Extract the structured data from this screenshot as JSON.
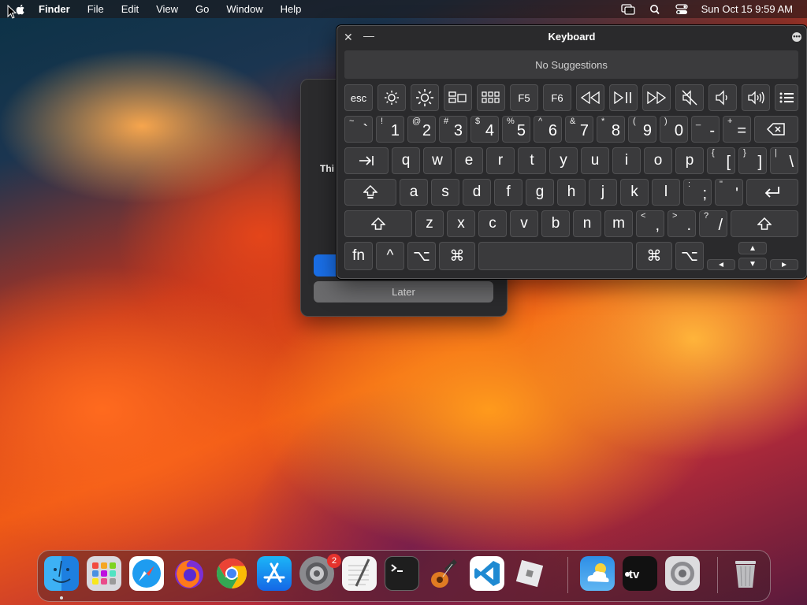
{
  "menubar": {
    "app_name": "Finder",
    "menus": [
      "File",
      "Edit",
      "View",
      "Go",
      "Window",
      "Help"
    ],
    "clock": "Sun Oct 15  9:59 AM",
    "icons": [
      "screen-mirroring-icon",
      "spotlight-search-icon",
      "control-center-icon"
    ]
  },
  "dialog": {
    "snippet": "Thi",
    "later_label": "Later"
  },
  "keyboard": {
    "title": "Keyboard",
    "suggestions": "No Suggestions",
    "function_row": [
      "esc",
      "brightness-down-icon",
      "brightness-up-icon",
      "mission-control-icon",
      "launchpad-icon",
      "F5",
      "F6",
      "rewind-icon",
      "play-pause-icon",
      "fast-forward-icon",
      "mute-icon",
      "volume-down-icon",
      "volume-up-icon",
      "list-icon"
    ],
    "number_row": [
      {
        "shift": "~",
        "main": "`"
      },
      {
        "shift": "!",
        "main": "1"
      },
      {
        "shift": "@",
        "main": "2"
      },
      {
        "shift": "#",
        "main": "3"
      },
      {
        "shift": "$",
        "main": "4"
      },
      {
        "shift": "%",
        "main": "5"
      },
      {
        "shift": "^",
        "main": "6"
      },
      {
        "shift": "&",
        "main": "7"
      },
      {
        "shift": "*",
        "main": "8"
      },
      {
        "shift": "(",
        "main": "9"
      },
      {
        "shift": ")",
        "main": "0"
      },
      {
        "shift": "_",
        "main": "-"
      },
      {
        "shift": "+",
        "main": "="
      }
    ],
    "q_row": [
      "q",
      "w",
      "e",
      "r",
      "t",
      "y",
      "u",
      "i",
      "o",
      "p"
    ],
    "q_row_extra": [
      {
        "shift": "{",
        "main": "["
      },
      {
        "shift": "}",
        "main": "]"
      },
      {
        "shift": "|",
        "main": "\\"
      }
    ],
    "a_row": [
      "a",
      "s",
      "d",
      "f",
      "g",
      "h",
      "j",
      "k",
      "l"
    ],
    "a_row_extra": [
      {
        "shift": ":",
        "main": ";"
      },
      {
        "shift": "\"",
        "main": "'"
      }
    ],
    "z_row": [
      "z",
      "x",
      "c",
      "v",
      "b",
      "n",
      "m"
    ],
    "z_row_extra": [
      {
        "shift": "<",
        "main": ","
      },
      {
        "shift": ">",
        "main": "."
      },
      {
        "shift": "?",
        "main": "/"
      }
    ],
    "bottom_row": {
      "fn": "fn",
      "control": "^",
      "option": "⌥",
      "command": "⌘"
    }
  },
  "dock": {
    "apps": [
      "Finder",
      "Launchpad",
      "Safari",
      "Firefox",
      "Google Chrome",
      "App Store",
      "System Settings",
      "TextEdit",
      "Terminal",
      "GarageBand",
      "Visual Studio Code",
      "Roblox",
      "Weather",
      "Apple TV",
      "System Preferences",
      "Trash"
    ],
    "settings_badge": "2"
  }
}
